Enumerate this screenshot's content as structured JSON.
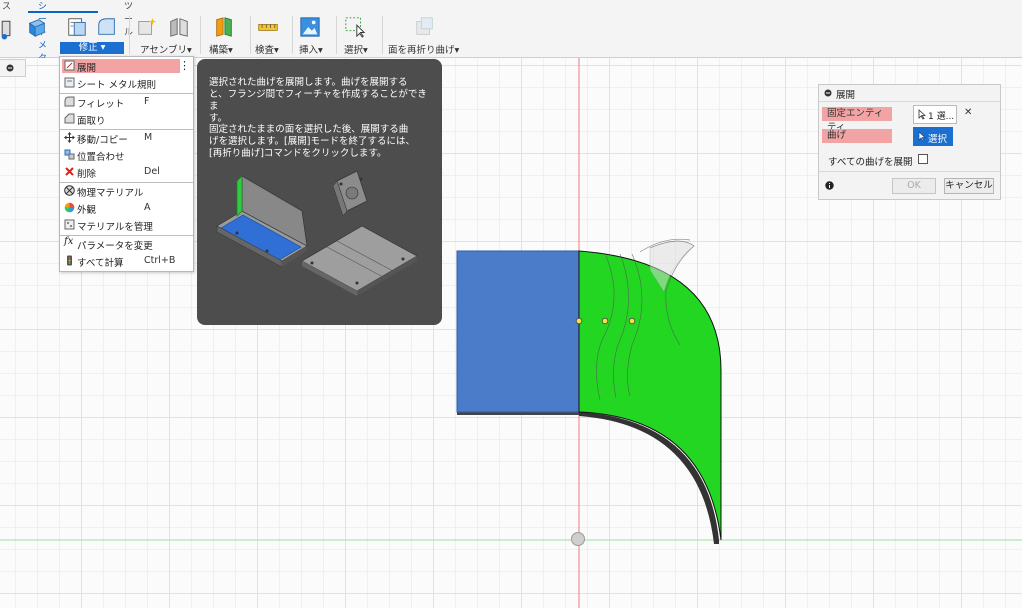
{
  "tabs": {
    "partial": "ス",
    "sheet_metal": "シート メタル",
    "tools": "ツール"
  },
  "toolbar": {
    "modify": "修正",
    "assemble": "アセンブリ",
    "construct": "構築",
    "inspect": "検査",
    "insert": "挿入",
    "select": "選択",
    "refold": "面を再折り曲げ",
    "dropdown_arrow": "▾"
  },
  "browser_stub": {
    "icon": "collapse-icon"
  },
  "menu": {
    "items": [
      {
        "label": "展開",
        "key": "",
        "icon": "unfold-icon"
      },
      {
        "label": "シート メタル規則",
        "key": "",
        "icon": "sheet-rule-icon"
      },
      {
        "label": "フィレット",
        "key": "F",
        "icon": "fillet-icon"
      },
      {
        "label": "面取り",
        "key": "",
        "icon": "chamfer-icon"
      },
      {
        "label": "移動/コピー",
        "key": "M",
        "icon": "move-icon"
      },
      {
        "label": "位置合わせ",
        "key": "",
        "icon": "align-icon"
      },
      {
        "label": "削除",
        "key": "Del",
        "icon": "delete-icon"
      },
      {
        "label": "物理マテリアル",
        "key": "",
        "icon": "physical-material-icon"
      },
      {
        "label": "外観",
        "key": "A",
        "icon": "appearance-icon"
      },
      {
        "label": "マテリアルを管理",
        "key": "",
        "icon": "manage-material-icon"
      },
      {
        "label": "パラメータを変更",
        "key": "",
        "icon": "parameters-icon"
      },
      {
        "label": "すべて計算",
        "key": "Ctrl+B",
        "icon": "compute-all-icon"
      }
    ],
    "more": "⋮"
  },
  "tooltip": {
    "para1_line1": "選択された曲げを展開します。曲げを展開する",
    "para1_line2": "と、フランジ間でフィーチャを作成することができま",
    "para1_line3": "す。",
    "para2_line1": "固定されたままの面を選択した後、展開する曲",
    "para2_line2": "げを選択します。[展開]モードを終了するには、",
    "para2_line3": "[再折り曲げ]コマンドをクリックします。"
  },
  "panel": {
    "title": "展開",
    "fixed_entity_label": "固定エンティティ",
    "fixed_entity_value": "1 選...",
    "bends_label": "曲げ",
    "bends_button": "選択",
    "unfold_all_label": "すべての曲げを展開",
    "ok": "OK",
    "cancel": "キャンセル",
    "clear": "✕"
  },
  "colors": {
    "accent": "#1a6fd1",
    "highlight": "#f2a3a3",
    "blue_face": "#4a7cc9",
    "green_face": "#22d622",
    "tooltip_bg": "#4d4d4d"
  }
}
